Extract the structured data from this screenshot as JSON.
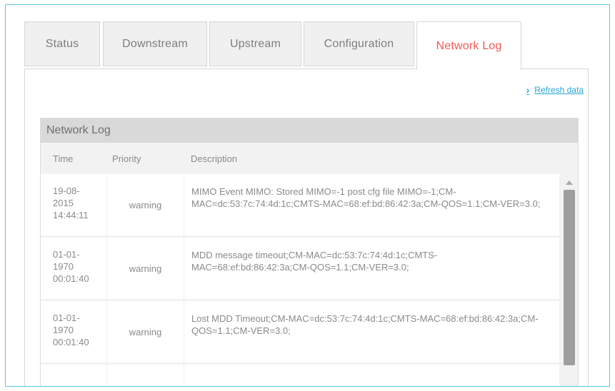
{
  "tabs": [
    {
      "label": "Status",
      "active": false
    },
    {
      "label": "Downstream",
      "active": false
    },
    {
      "label": "Upstream",
      "active": false
    },
    {
      "label": "Configuration",
      "active": false
    },
    {
      "label": "Network Log",
      "active": true
    }
  ],
  "refresh": {
    "icon": "chevron-right-icon",
    "label": "Refresh data"
  },
  "log": {
    "title": "Network Log",
    "columns": {
      "time": "Time",
      "priority": "Priority",
      "description": "Description"
    },
    "rows": [
      {
        "time": [
          "19-08-",
          "2015",
          "14:44:11"
        ],
        "priority": "warning",
        "description": "MIMO Event MIMO: Stored MIMO=-1 post cfg file MIMO=-1;CM-MAC=dc:53:7c:74:4d:1c;CMTS-MAC=68:ef:bd:86:42:3a;CM-QOS=1.1;CM-VER=3.0;"
      },
      {
        "time": [
          "01-01-",
          "1970",
          "00:01:40"
        ],
        "priority": "warning",
        "description": "MDD message timeout;CM-MAC=dc:53:7c:74:4d:1c;CMTS-MAC=68:ef:bd:86:42:3a;CM-QOS=1.1;CM-VER=3.0;"
      },
      {
        "time": [
          "01-01-",
          "1970",
          "00:01:40"
        ],
        "priority": "warning",
        "description": "Lost MDD Timeout;CM-MAC=dc:53:7c:74:4d:1c;CMTS-MAC=68:ef:bd:86:42:3a;CM-QOS=1.1;CM-VER=3.0;"
      }
    ]
  },
  "colors": {
    "accent": "#ef5a53",
    "link": "#26a3d3",
    "frame": "#5cc6e6"
  }
}
